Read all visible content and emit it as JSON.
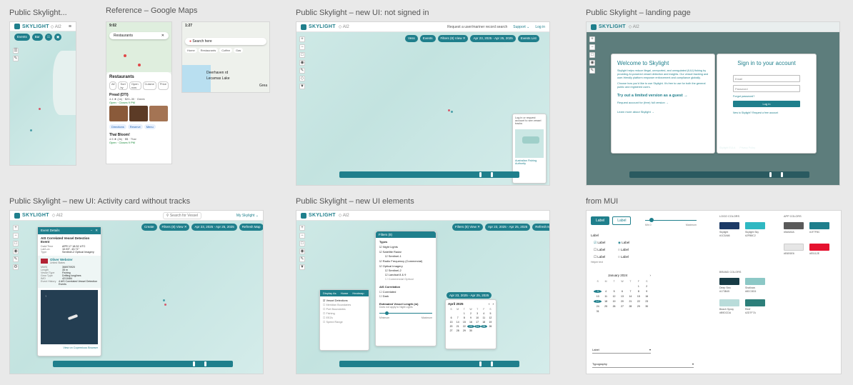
{
  "frames": {
    "mobile": {
      "label": "Public Skylight...",
      "logo": "SKYLIGHT",
      "logo_sub": "◇ AI2",
      "pills": [
        "Events",
        "Bar"
      ]
    },
    "google": {
      "label": "Reference – Google Maps",
      "left_screen": {
        "time": "9:02",
        "search": "Restaurants",
        "sheet_title": "Restaurants",
        "filters": [
          "All",
          "Sort by",
          "Open now",
          "Cuisine",
          "Price"
        ],
        "result1_title": "Pread (DTI)",
        "result1_meta": "4.4 ★ (1k) · $20–30 · Greek",
        "result1_status": "Open · Closes 9 PM",
        "result1_actions": [
          "Directions",
          "Reserve",
          "Menu"
        ],
        "result2_title": "Thai Bloom!",
        "result2_meta": "4.5 ★ (2k) · $$ · Thai",
        "result2_status": "Open · Closes 9 PM"
      },
      "right_screen": {
        "time": "1:27",
        "search": "Search here",
        "chips": [
          "Home",
          "Restaurants",
          "Coffee",
          "Gas"
        ],
        "place1": "Deerhaven rd",
        "place2": "Lecamas Lake",
        "place3": "Grea"
      }
    },
    "not_signed": {
      "label": "Public Skylight – new UI: not signed in",
      "logo": "SKYLIGHT",
      "logo_sub": "◇ AI2",
      "top_right": [
        "Request a user/mariner record search",
        "Support ⌄",
        "Log in"
      ],
      "pills": [
        "Vess",
        "Events",
        "Filters (8)  View ✕",
        "Apr 23, 2025 - Apr 25, 2025",
        "Events List"
      ],
      "callout": "Log in or request account to see vessel tracks",
      "inset_label": "Australian Fishing Authority"
    },
    "landing": {
      "label": "Public Skylight – landing page",
      "logo": "SKYLIGHT",
      "logo_sub": "◇ AI2",
      "welcome_title": "Welcome to Skylight",
      "welcome_p1": "Skylight helps reduce illegal, unreported, and unregulated (IUU) fishing by providing AI-powered vessel detection and insights. Our vessel tracking and user-friendly platform empower enforcement and compliance globally.",
      "welcome_p2": "Choose how you'd like to use Skylight. It's free to use for both the general public and registered users.",
      "guest_link": "Try out a limited version as a guest →",
      "request_link": "Request account for (free) full version →",
      "learn_link": "Learn more about Skylight →",
      "signin_title": "Sign in to your account",
      "email_placeholder": "Email",
      "password_placeholder": "Password",
      "forgot": "Forgot password?",
      "login_button": "Log in",
      "new_user": "New to Skylight? Request a free account",
      "guest_alt": "Or continue as a guest →",
      "eula": "Skylight EULA",
      "privacy": "Privacy Policy"
    },
    "activity": {
      "label": "Public Skylight – new UI: Activity card without tracks",
      "logo": "SKYLIGHT",
      "logo_sub": "◇ AI2",
      "search_placeholder": "Search for Vessel",
      "my_skylight": "My Skylight ⌄",
      "pills": [
        "Create",
        "Filters (8)  View ✕",
        "Apr 23, 2025 - Apr 25, 2025",
        "Refresh Map"
      ],
      "card_header": "Event Details",
      "card_title": "AIS Correlated Vessel Detection Event",
      "rows": [
        [
          "Date/Time",
          "APR 17 18:32 UTC"
        ],
        [
          "Lat/Lon",
          "10.93°, 43.71°"
        ],
        [
          "Type",
          "Sentinel-2 Optical Imagery"
        ]
      ],
      "vessel_name": "Oliver Webster",
      "vessel_flag": "United States",
      "vessel_rows": [
        [
          "MMSI",
          "366970920"
        ],
        [
          "Length",
          "35 m"
        ],
        [
          "Vessel Type",
          "Fishing"
        ],
        [
          "Gear Type",
          "Drifting longlines"
        ],
        [
          "IMO",
          "4213484"
        ],
        [
          "Event History",
          "4 AIS Correlated Vessel Detection Events"
        ]
      ],
      "image_caption": "View on Copernicus Browser"
    },
    "elements": {
      "label": "Public Skylight – new UI elements",
      "logo": "SKYLIGHT",
      "logo_sub": "◇ AI2",
      "filter_title": "Filters (8)",
      "types_heading": "Types",
      "types": [
        "Night Lights",
        "Satellite Radar",
        "Sentinel-1",
        "Radio Frequency (Commercial)",
        "Optical Imagery",
        "Sentinel-2",
        "Landsat 8 & 9",
        "Commercial Optical"
      ],
      "ais_heading": "AIS Correlation",
      "ais_options": [
        "Correlated",
        "Dark"
      ],
      "length_heading": "Estimated Vessel Length (m)",
      "length_sub": "Does not apply to Night Lights",
      "length_range": [
        "Minimum",
        "Maximum"
      ],
      "layers_title": "Display As",
      "layers_tabs": [
        "Home",
        "Heatmap"
      ],
      "layers_items": [
        "Vessel Detections",
        "Meridian Boundaries",
        "Port Boundaries",
        "Fishing",
        "EEZs",
        "Speed Range"
      ],
      "date_pill": "Apr 23, 2025 - Apr 25, 2025",
      "cal_month": "April 2025",
      "cal_days": [
        "S",
        "M",
        "T",
        "W",
        "T",
        "F",
        "S"
      ],
      "cal_dates": [
        "",
        "",
        "1",
        "2",
        "3",
        "4",
        "5",
        "6",
        "7",
        "8",
        "9",
        "10",
        "11",
        "12",
        "13",
        "14",
        "15",
        "16",
        "17",
        "18",
        "19",
        "20",
        "21",
        "22",
        "23",
        "24",
        "25",
        "26",
        "27",
        "28",
        "29",
        "30",
        "",
        "",
        ""
      ],
      "pills": [
        "Filters (8)  View ✕",
        "Apr 23, 2025 - Apr 25, 2025",
        "Refresh Map"
      ]
    },
    "mui": {
      "label": "from MUI",
      "buttons": [
        "Label",
        "Label"
      ],
      "slider_min": "Min 0",
      "slider_max": "Maximum",
      "checkbox_title": "Label",
      "checkbox_labels": [
        "Label",
        "Label",
        "Label"
      ],
      "radio_labels": [
        "Label",
        "Label",
        "Label"
      ],
      "helper": "Helper text",
      "cal_month": "January 2024",
      "cal_days": [
        "S",
        "M",
        "T",
        "W",
        "T",
        "F",
        "S"
      ],
      "cal_dates": [
        "",
        "",
        "",
        "",
        "",
        "1",
        "2",
        "3",
        "4",
        "5",
        "6",
        "7",
        "8",
        "9",
        "10",
        "11",
        "12",
        "13",
        "14",
        "15",
        "16",
        "17",
        "18",
        "19",
        "20",
        "21",
        "22",
        "23",
        "24",
        "25",
        "26",
        "27",
        "28",
        "29",
        "30",
        "31"
      ],
      "select1": "Label",
      "select2": "Typography",
      "logo_colors_title": "LOGO COLORS",
      "app_colors_title": "APP COLORS",
      "brand_colors_title": "BRAND COLORS",
      "logo_colors": [
        {
          "name": "Skylight",
          "hex": "#1C3A66",
          "color": "#1C3A66"
        },
        {
          "name": "Skylight Sky",
          "hex": "#2FB8C2",
          "color": "#2FB8C2"
        }
      ],
      "app_colors": [
        {
          "name": "#5A5A5A",
          "hex": "#5A5A5A",
          "color": "#5A5A5A"
        },
        {
          "name": "#1F7F8C",
          "hex": "#1F7F8C",
          "color": "#1F7F8C"
        },
        {
          "name": "#E6E6E6",
          "hex": "#E6E6E6",
          "color": "#E6E6E6"
        },
        {
          "name": "#E5112E",
          "hex": "#E5112E",
          "color": "#E5112E"
        }
      ],
      "brand_colors": [
        {
          "name": "Deep Sea",
          "hex": "#173B45",
          "color": "#173B45"
        },
        {
          "name": "Shallows",
          "hex": "#8CC8C6",
          "color": "#8CC8C6"
        },
        {
          "name": "Beach Spray",
          "hex": "#B9DCDA",
          "color": "#B9DCDA"
        },
        {
          "name": "Reef",
          "hex": "#2D7F7A",
          "color": "#2D7F7A"
        }
      ]
    }
  },
  "colors": {
    "accent": "#1f7f8c",
    "map_water": "#c9e6e4",
    "dim_overlay": "#5d7d7c"
  }
}
